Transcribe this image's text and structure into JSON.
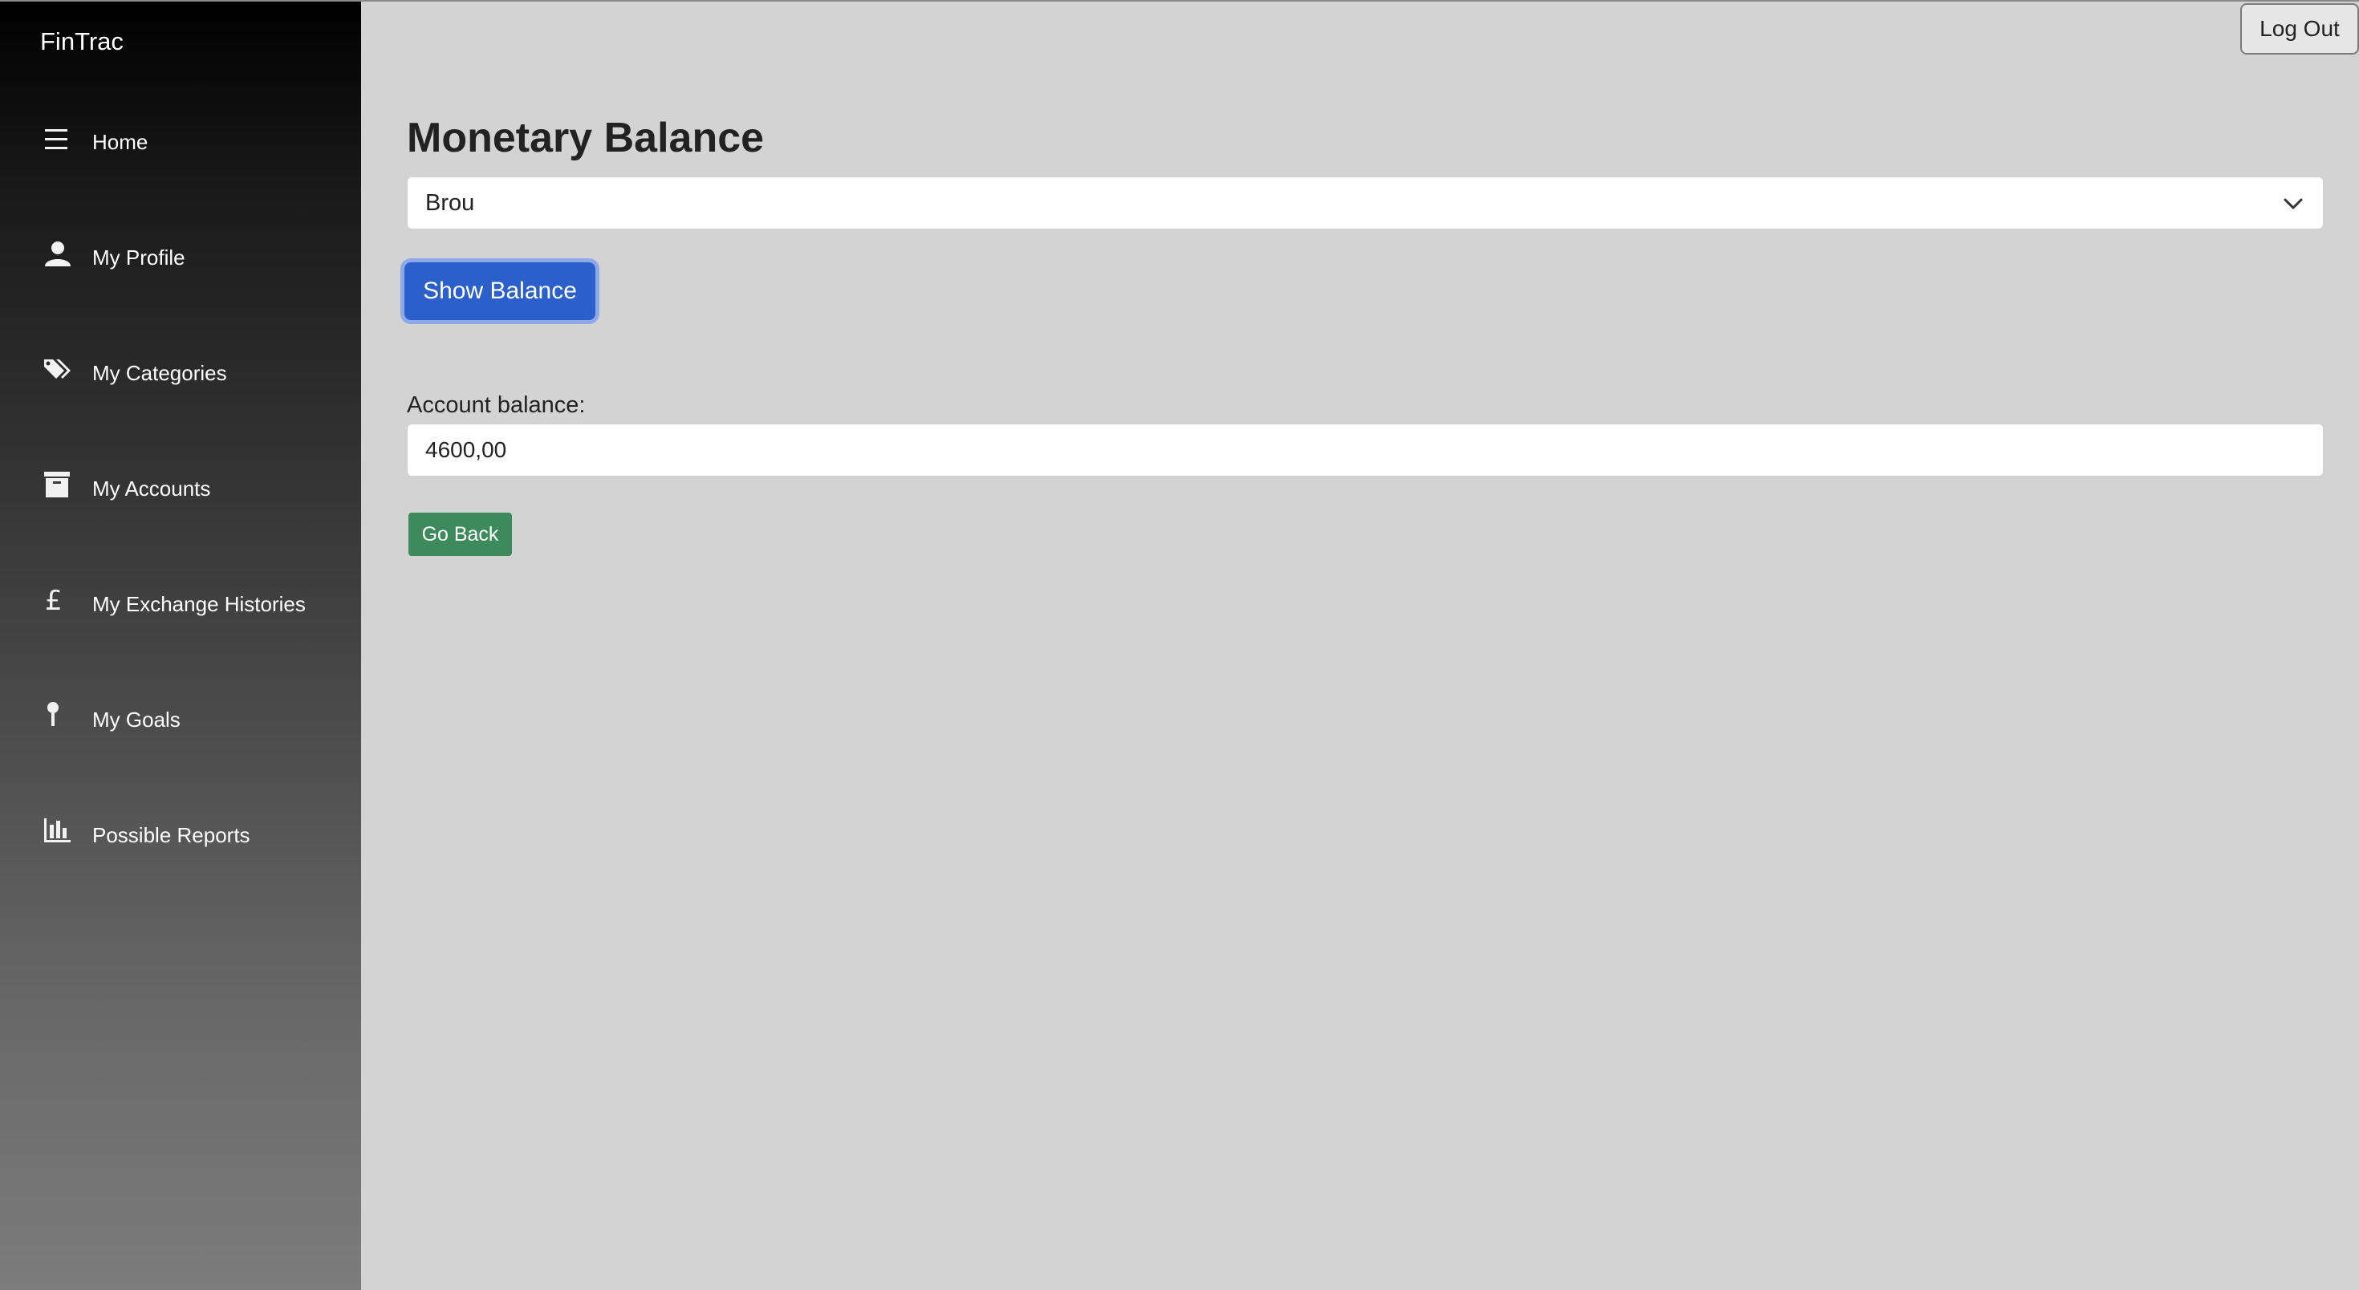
{
  "app": {
    "brand": "FinTrac"
  },
  "sidebar": {
    "items": [
      {
        "label": "Home",
        "icon": "menu-icon"
      },
      {
        "label": "My Profile",
        "icon": "user-icon"
      },
      {
        "label": "My Categories",
        "icon": "tags-icon"
      },
      {
        "label": "My Accounts",
        "icon": "archive-icon"
      },
      {
        "label": "My Exchange Histories",
        "icon": "pound-icon"
      },
      {
        "label": "My Goals",
        "icon": "pin-icon"
      },
      {
        "label": "Possible Reports",
        "icon": "bar-chart-icon"
      }
    ]
  },
  "header": {
    "logout_label": "Log Out"
  },
  "main": {
    "title": "Monetary Balance",
    "account_select": {
      "selected": "Brou"
    },
    "show_balance_label": "Show Balance",
    "balance_label": "Account balance:",
    "balance_value": "4600,00",
    "go_back_label": "Go Back"
  },
  "colors": {
    "primary": "#2a5fcc",
    "success": "#3d8b5c",
    "background": "#d3d3d3"
  }
}
